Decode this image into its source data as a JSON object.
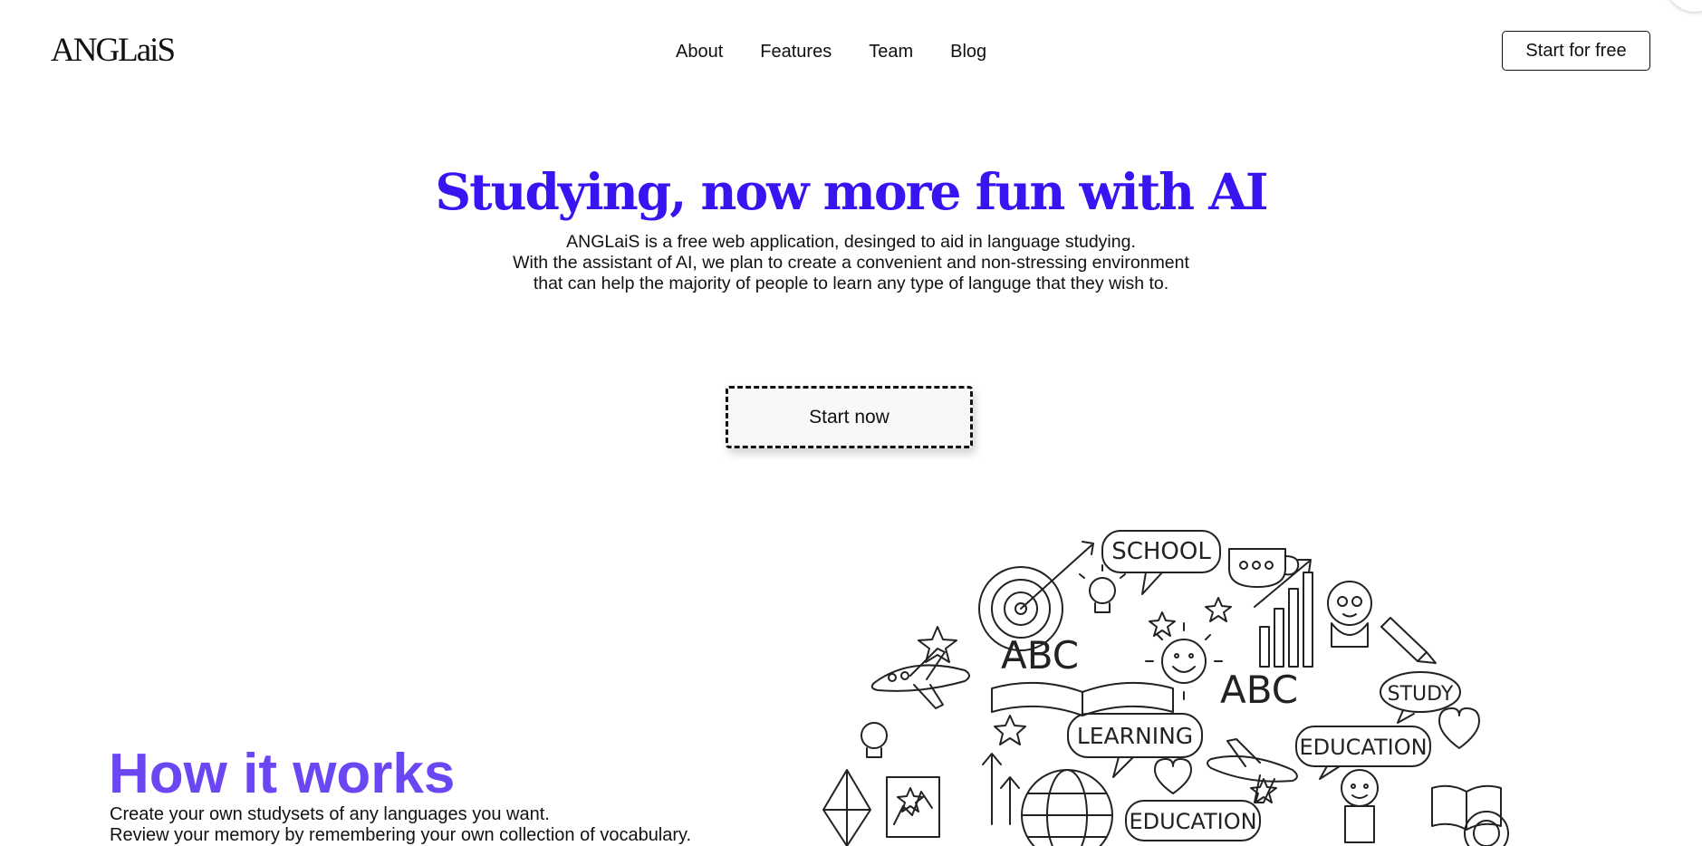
{
  "header": {
    "logo": "ANGLaiS",
    "nav": [
      "About",
      "Features",
      "Team",
      "Blog"
    ],
    "cta": "Start for free"
  },
  "hero": {
    "title": "Studying, now more fun with AI",
    "description": [
      "ANGLaiS is a free web application, desinged to aid in language studying.",
      "With the assistant of AI, we plan to create a convenient and non-stressing environment",
      "that can help the majority of people to learn any type of languge that they wish to."
    ],
    "button": "Start now"
  },
  "how_it_works": {
    "title": "How it works",
    "lines": [
      "Create your own studysets of any languages you want.",
      "Review your memory by remembering your own collection of vocabulary."
    ]
  },
  "illustration": {
    "labels": [
      "SCHOOL",
      "ABC",
      "ABC",
      "STUDY",
      "LEARNING",
      "EDUCATION",
      "EDUCATION"
    ]
  },
  "colors": {
    "hero_title": "#3a14f0",
    "how_title": "#6a47f2",
    "text": "#111111"
  }
}
